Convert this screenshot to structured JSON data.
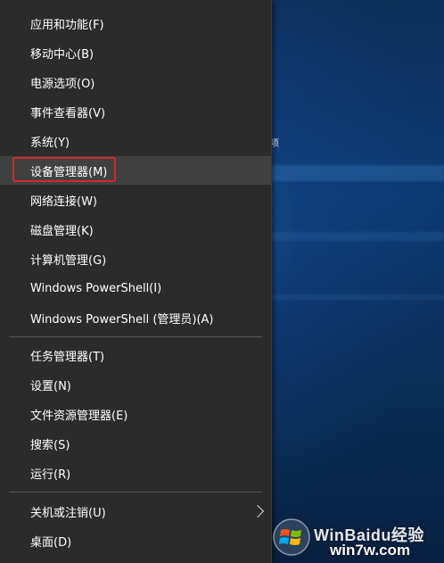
{
  "menu": {
    "items": [
      {
        "label": "应用和功能(F)"
      },
      {
        "label": "移动中心(B)"
      },
      {
        "label": "电源选项(O)"
      },
      {
        "label": "事件查看器(V)"
      },
      {
        "label": "系统(Y)"
      },
      {
        "label": "设备管理器(M)",
        "highlighted": true
      },
      {
        "label": "网络连接(W)"
      },
      {
        "label": "磁盘管理(K)"
      },
      {
        "label": "计算机管理(G)"
      },
      {
        "label": "Windows PowerShell(I)"
      },
      {
        "label": "Windows PowerShell (管理员)(A)"
      },
      {
        "label": "任务管理器(T)"
      },
      {
        "label": "设置(N)"
      },
      {
        "label": "文件资源管理器(E)"
      },
      {
        "label": "搜索(S)"
      },
      {
        "label": "运行(R)"
      },
      {
        "label": "关机或注销(U)",
        "has_submenu": true,
        "submenu_icon": "chevron-right-icon"
      },
      {
        "label": "桌面(D)"
      }
    ],
    "highlight_color": "#d6262d"
  },
  "desktop": {
    "partial_text": "项"
  },
  "watermark": {
    "text": "WinBaidu经验",
    "url": "win7w.com",
    "logo_icon": "windows-flag-icon"
  }
}
